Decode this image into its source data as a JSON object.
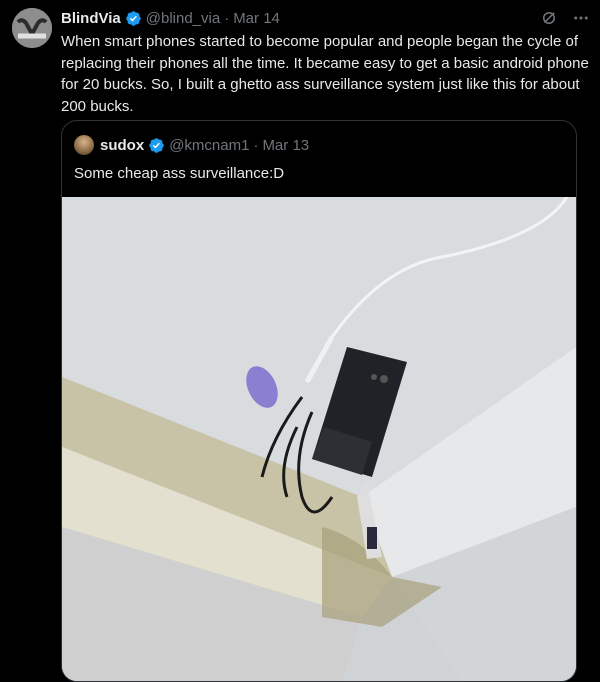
{
  "tweet": {
    "author_name": "BlindVia",
    "handle": "@blind_via",
    "separator": "·",
    "date": "Mar 14",
    "text": "When smart phones started to become popular and people began the cycle of replacing their phones all the time. It became easy to get a basic android phone for 20 bucks. So, I built a ghetto ass surveillance system just like this for about 200 bucks.",
    "icons": {
      "grok": "grok-icon",
      "more": "more-icon",
      "verified": "verified-badge-icon"
    },
    "colors": {
      "verified": "#1d9bf0",
      "muted": "#71767b",
      "text": "#e7e9ea",
      "border": "#2f3336"
    }
  },
  "quote": {
    "author_name": "sudox",
    "handle": "@kmcnam1",
    "separator": "·",
    "date": "Mar 13",
    "text": "Some cheap ass surveillance:D"
  }
}
